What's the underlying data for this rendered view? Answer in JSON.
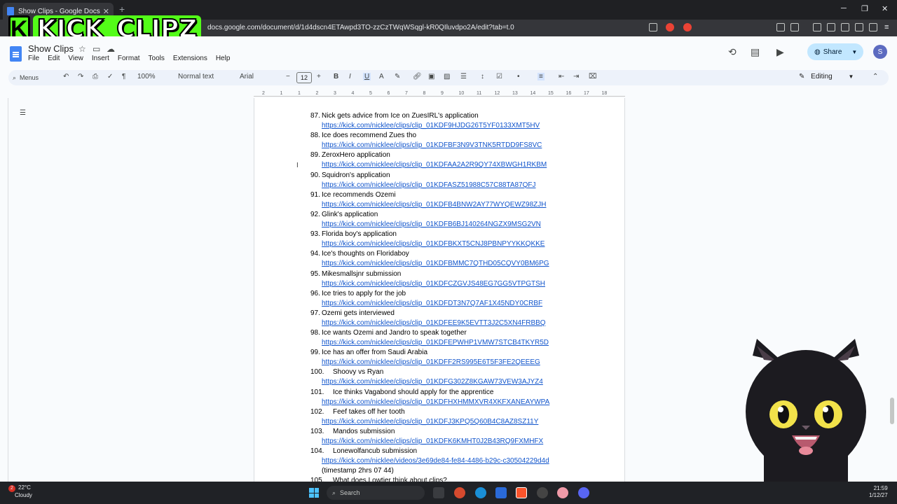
{
  "browser": {
    "tab_title": "Show Clips - Google Docs",
    "url": "docs.google.com/document/d/1d4dscn4ETAwpd3TO-zzCzTWqWSqgl-kR0QIluvdpo2A/edit?tab=t.0"
  },
  "overlay": {
    "logo_letter": "K",
    "logo_text": "KICK_CLIPZ"
  },
  "doc": {
    "title": "Show Clips",
    "menu": [
      "File",
      "Edit",
      "View",
      "Insert",
      "Format",
      "Tools",
      "Extensions",
      "Help"
    ],
    "share_label": "Share",
    "avatar_initial": "S"
  },
  "toolbar": {
    "menus_label": "Menus",
    "zoom": "100%",
    "style": "Normal text",
    "font": "Arial",
    "font_size": "12",
    "mode": "Editing"
  },
  "ruler_ticks": [
    "2",
    "1",
    "1",
    "2",
    "3",
    "4",
    "5",
    "6",
    "7",
    "8",
    "9",
    "10",
    "11",
    "12",
    "13",
    "14",
    "15",
    "16",
    "17",
    "18"
  ],
  "entries": [
    {
      "num": "87.",
      "title": "Nick gets advice from Ice on ZuesIRL's application",
      "link": "https://kick.com/nicklee/clips/clip_01KDF9HJDG26T5YF0133XMT5HV"
    },
    {
      "num": "88.",
      "title": "Ice does recommend Zues tho",
      "link": "https://kick.com/nicklee/clips/clip_01KDFBF3N9V3TNK5RTDD9FS8VC"
    },
    {
      "num": "89.",
      "title": "ZeroxHero application",
      "link": "https://kick.com/nicklee/clips/clip_01KDFAA2A2R9QY74XBWGH1RKBM"
    },
    {
      "num": "90.",
      "title": "Squidron's application",
      "link": "https://kick.com/nicklee/clips/clip_01KDFASZ51988C57C88TA87QFJ"
    },
    {
      "num": "91.",
      "title": "Ice recommends Ozemi",
      "link": "https://kick.com/nicklee/clips/clip_01KDFB4BNW2AY77WYQEWZ98ZJH"
    },
    {
      "num": "92.",
      "title": "Glink's application",
      "link": "https://kick.com/nicklee/clips/clip_01KDFB6BJ140264NGZX9MSG2VN"
    },
    {
      "num": "93.",
      "title": "Florida boy's application",
      "link": "https://kick.com/nicklee/clips/clip_01KDFBKXT5CNJ8PBNPYYKKQKKE"
    },
    {
      "num": "94.",
      "title": "Ice's thoughts on Floridaboy",
      "link": "https://kick.com/nicklee/clips/clip_01KDFBMMC7QTHD05CQVY0BM6PG"
    },
    {
      "num": "95.",
      "title": "Mikesmallsjnr submission",
      "link": "https://kick.com/nicklee/clips/clip_01KDFCZGVJS48EG7GG5VTPGTSH"
    },
    {
      "num": "96.",
      "title": "Ice tries to apply for the job",
      "link": "https://kick.com/nicklee/clips/clip_01KDFDT3N7Q7AF1X45NDY0CRBF"
    },
    {
      "num": "97.",
      "title": "Ozemi gets interviewed",
      "link": "https://kick.com/nicklee/clips/clip_01KDFEE9K5EVTT3J2C5XN4FRBBQ"
    },
    {
      "num": "98.",
      "title": "Ice wants Ozemi and Jandro to speak together",
      "link": "https://kick.com/nicklee/clips/clip_01KDFEPWHP1VMW7STCB4TKYR5D"
    },
    {
      "num": "99.",
      "title": "Ice has an offer from Saudi Arabia",
      "link": "https://kick.com/nicklee/clips/clip_01KDFF2RS995E6T5F3FE2QEEEG"
    },
    {
      "num": "100.",
      "title": "Shoovy vs Ryan",
      "link": "https://kick.com/nicklee/clips/clip_01KDFG302Z8KGAW73VEW3AJYZ4"
    },
    {
      "num": "101.",
      "title": "Ice thinks Vagabond should apply for the apprentice",
      "link": "https://kick.com/nicklee/clips/clip_01KDFHXHMMXVR4XKFXANEAYWPA"
    },
    {
      "num": "102.",
      "title": "Feef takes off her tooth",
      "link": "https://kick.com/nicklee/clips/clip_01KDFJ3KPQ5Q60B4C8AZ8SZ11Y"
    },
    {
      "num": "103.",
      "title": "Mandos submission",
      "link": "https://kick.com/nicklee/clips/clip_01KDFK6KMHT0J2B43RQ9FXMHFX"
    },
    {
      "num": "104.",
      "title": "Lonewolfancub submission",
      "link": "https://kick.com/nicklee/videos/3e69de84-fe84-4486-b29c-c30504229d4d",
      "extra": "(timestamp 2hrs 07 44)"
    },
    {
      "num": "105.",
      "title": "What does Lowtier think about clips?",
      "link": ""
    }
  ],
  "taskbar": {
    "temp": "22°C",
    "weather": "Cloudy",
    "notif_count": "2",
    "search_placeholder": "Search",
    "time": "21:59",
    "date": "1/12/27"
  },
  "colors": {
    "accent": "#53fc18",
    "link": "#1155cc",
    "share_bg": "#c2e7ff"
  }
}
